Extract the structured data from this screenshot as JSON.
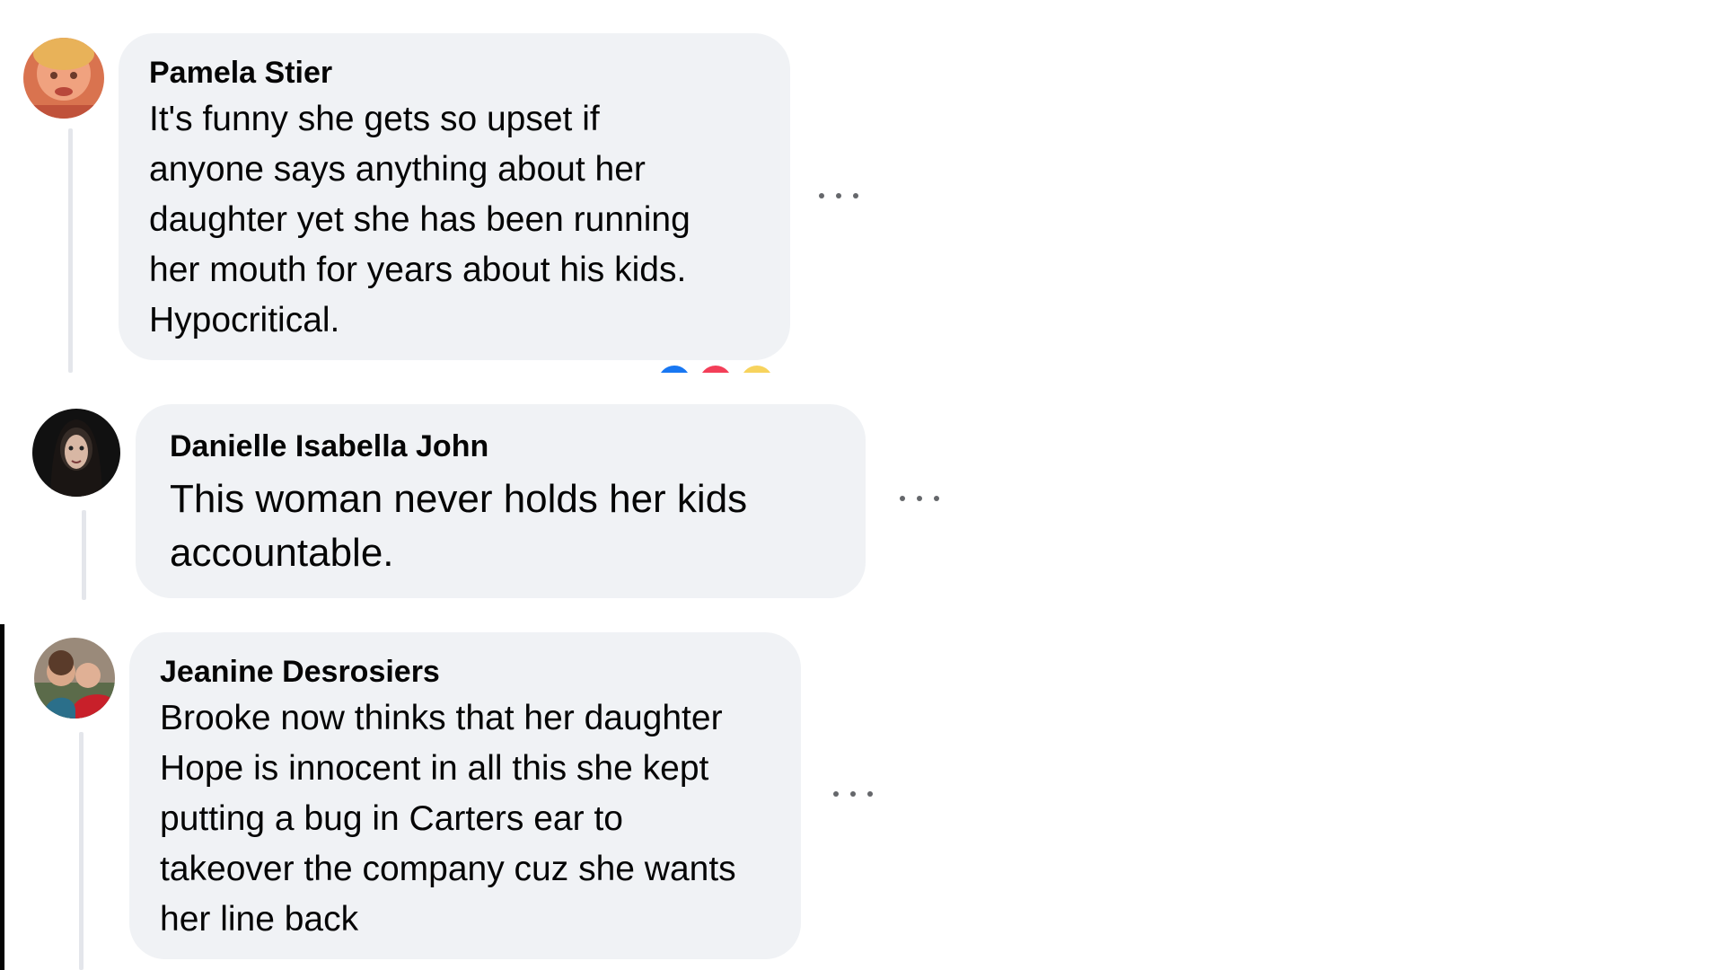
{
  "comments": [
    {
      "author": "Pamela Stier",
      "lines": [
        "It's funny she gets so upset if",
        "anyone says anything about her",
        "daughter yet she has been running",
        "her mouth for years about his kids.",
        "Hypocritical."
      ],
      "avatar_icon": "profile-photo-icon",
      "more_icon": "more-options-icon",
      "reactions": [
        {
          "icon": "like-reaction-icon",
          "color": "#1877f2"
        },
        {
          "icon": "love-reaction-icon",
          "color": "#f33e58"
        },
        {
          "icon": "haha-reaction-icon",
          "color": "#f7d35d"
        }
      ]
    },
    {
      "author": "Danielle Isabella John",
      "lines": [
        "This woman never holds her kids",
        "accountable."
      ],
      "avatar_icon": "profile-photo-icon",
      "more_icon": "more-options-icon"
    },
    {
      "author": "Jeanine Desrosiers",
      "lines": [
        "Brooke now thinks that her daughter",
        "Hope is innocent in all this she kept",
        "putting a bug in Carters ear to",
        "takeover the company cuz she wants",
        "her line back"
      ],
      "avatar_icon": "profile-photo-icon",
      "more_icon": "more-options-icon"
    }
  ],
  "colors": {
    "bubble": "#f0f2f5",
    "thread_line": "#e4e6eb",
    "text": "#050505",
    "more_dots": "#65676b"
  }
}
